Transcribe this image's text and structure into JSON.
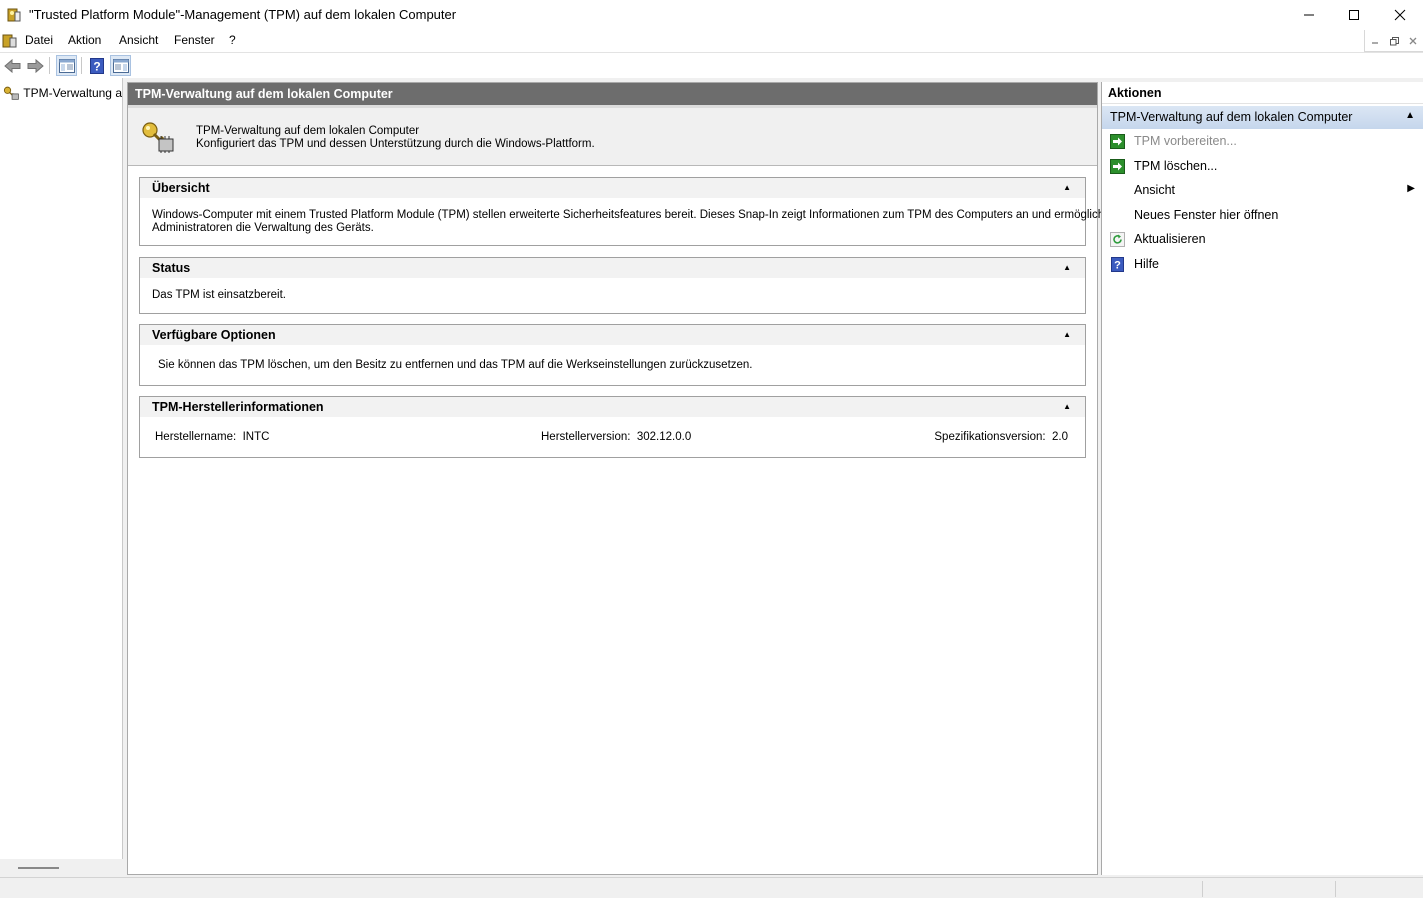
{
  "window": {
    "title": "\"Trusted Platform Module\"-Management (TPM) auf dem lokalen Computer",
    "buttons": [
      "minimize-icon",
      "maximize-icon",
      "close-icon"
    ]
  },
  "menubar": {
    "items": [
      "Datei",
      "Aktion",
      "Ansicht",
      "Fenster",
      "?"
    ]
  },
  "toolbar": {
    "buttons": [
      "back-arrow-icon",
      "forward-arrow-icon",
      "show-hide-console-tree-icon",
      "help-icon",
      "show-hide-action-pane-icon"
    ]
  },
  "tree": {
    "items": [
      {
        "label": "TPM-Verwaltung a",
        "icon": "tpm-key-icon"
      }
    ]
  },
  "main": {
    "header": "TPM-Verwaltung auf dem lokalen Computer",
    "banner": {
      "line1": "TPM-Verwaltung auf dem lokalen Computer",
      "line2": "Konfiguriert das TPM und dessen Unterstützung durch die Windows-Plattform."
    },
    "sections": {
      "overview": {
        "title": "Übersicht",
        "text_line1": "Windows-Computer mit einem Trusted Platform Module (TPM) stellen erweiterte Sicherheitsfeatures bereit. Dieses Snap-In zeigt Informationen zum TPM des Computers an und ermöglicht",
        "text_line2": "Administratoren die Verwaltung des Geräts."
      },
      "status": {
        "title": "Status",
        "text": "Das TPM ist einsatzbereit."
      },
      "options": {
        "title": "Verfügbare Optionen",
        "text": "Sie können das TPM löschen, um den Besitz zu entfernen und das TPM auf die Werkseinstellungen zurückzusetzen."
      },
      "manufacturer": {
        "title": "TPM-Herstellerinformationen",
        "name_label": "Herstellername:",
        "name_value": "INTC",
        "version_label": "Herstellerversion:",
        "version_value": "302.12.0.0",
        "spec_label": "Spezifikationsversion:",
        "spec_value": "2.0"
      }
    }
  },
  "actions": {
    "title": "Aktionen",
    "group": "TPM-Verwaltung auf dem lokalen Computer",
    "items": [
      {
        "label": "TPM vorbereiten...",
        "icon": "green-arrow-icon",
        "disabled": true
      },
      {
        "label": "TPM löschen...",
        "icon": "green-arrow-icon",
        "disabled": false
      },
      {
        "label": "Ansicht",
        "icon": "",
        "submenu": true
      },
      {
        "label": "Neues Fenster hier öffnen",
        "icon": ""
      },
      {
        "label": "Aktualisieren",
        "icon": "refresh-icon"
      },
      {
        "label": "Hilfe",
        "icon": "help-icon"
      }
    ]
  },
  "colors": {
    "header_bg": "#6d6d6d",
    "action_group_bg": "#c5d6ec",
    "disabled_text": "#8a8a8a"
  }
}
